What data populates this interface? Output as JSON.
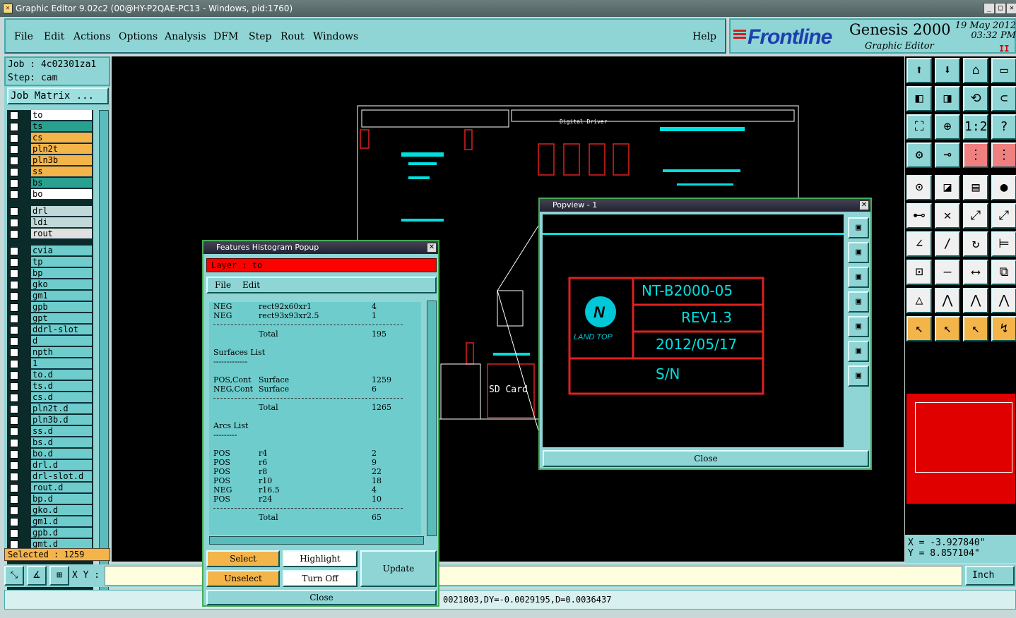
{
  "window": {
    "title": "Graphic Editor 9.02c2 (00@HY-P2QAE-PC13 - Windows, pid:1760)"
  },
  "menubar": {
    "items": [
      "File",
      "Edit",
      "Actions",
      "Options",
      "Analysis",
      "DFM",
      "Step",
      "Rout",
      "Windows"
    ],
    "help": "Help"
  },
  "brand": {
    "logo": "Frontline",
    "product": "Genesis 2000",
    "subtitle": "Graphic Editor",
    "date": "19 May 2012",
    "time": "03:32 PM",
    "pause": "II"
  },
  "job": {
    "job": "Job : 4c02301za1",
    "step": "Step: cam",
    "matrix_button": "Job Matrix ..."
  },
  "layers": [
    {
      "name": "to",
      "color": "#ffffff"
    },
    {
      "name": "ts",
      "color": "#2aa090"
    },
    {
      "name": "cs",
      "color": "#f3b44a"
    },
    {
      "name": "pln2t",
      "color": "#f3b44a"
    },
    {
      "name": "pln3b",
      "color": "#f3b44a"
    },
    {
      "name": "ss",
      "color": "#f3b44a"
    },
    {
      "name": "bs",
      "color": "#2aa090"
    },
    {
      "name": "bo",
      "color": "#ffffff"
    },
    {
      "name": "drl",
      "color": "#c0d8d8"
    },
    {
      "name": "ldi",
      "color": "#c0d8d8"
    },
    {
      "name": "rout",
      "color": "#e0e0e0"
    },
    {
      "name": "cvia",
      "color": "#6ecccc"
    },
    {
      "name": "tp",
      "color": "#6ecccc"
    },
    {
      "name": "bp",
      "color": "#6ecccc"
    },
    {
      "name": "gko",
      "color": "#6ecccc"
    },
    {
      "name": "gm1",
      "color": "#6ecccc"
    },
    {
      "name": "gpb",
      "color": "#6ecccc"
    },
    {
      "name": "gpt",
      "color": "#6ecccc"
    },
    {
      "name": "ddrl-slot",
      "color": "#6ecccc"
    },
    {
      "name": "d",
      "color": "#6ecccc"
    },
    {
      "name": "npth",
      "color": "#6ecccc"
    },
    {
      "name": "1",
      "color": "#6ecccc"
    },
    {
      "name": "to.d",
      "color": "#6ecccc"
    },
    {
      "name": "ts.d",
      "color": "#6ecccc"
    },
    {
      "name": "cs.d",
      "color": "#6ecccc"
    },
    {
      "name": "pln2t.d",
      "color": "#6ecccc"
    },
    {
      "name": "pln3b.d",
      "color": "#6ecccc"
    },
    {
      "name": "ss.d",
      "color": "#6ecccc"
    },
    {
      "name": "bs.d",
      "color": "#6ecccc"
    },
    {
      "name": "bo.d",
      "color": "#6ecccc"
    },
    {
      "name": "drl.d",
      "color": "#6ecccc"
    },
    {
      "name": "drl-slot.d",
      "color": "#6ecccc"
    },
    {
      "name": "rout.d",
      "color": "#6ecccc"
    },
    {
      "name": "bp.d",
      "color": "#6ecccc"
    },
    {
      "name": "gko.d",
      "color": "#6ecccc"
    },
    {
      "name": "gm1.d",
      "color": "#6ecccc"
    },
    {
      "name": "gpb.d",
      "color": "#6ecccc"
    },
    {
      "name": "gmt.d",
      "color": "#6ecccc"
    }
  ],
  "selected": "Selected : 1259",
  "coords": {
    "x": "X = -3.927840\"",
    "y": "Y = 8.857104\""
  },
  "bottombar": {
    "xy_label": "X Y :",
    "unit": "Inch"
  },
  "status": {
    "text": "0021803,DY=-0.0029195,D=0.0036437"
  },
  "histogram": {
    "title": "Features Histogram Popup",
    "layer": "Layer :  to",
    "menu": [
      "File",
      "Edit"
    ],
    "rows": [
      [
        "NEG",
        "rect92x60xr1",
        "4"
      ],
      [
        "NEG",
        "rect93x93xr2.5",
        "1"
      ],
      [
        "sep"
      ],
      [
        "",
        "Total",
        "195"
      ],
      [
        "",
        ""
      ],
      [
        "head",
        "Surfaces List"
      ],
      [
        "head",
        "-------------"
      ],
      [
        "",
        ""
      ],
      [
        "POS,Cont",
        "Surface",
        "1259"
      ],
      [
        "NEG,Cont",
        "Surface",
        "6"
      ],
      [
        "sep"
      ],
      [
        "",
        "Total",
        "1265"
      ],
      [
        "",
        ""
      ],
      [
        "head",
        "Arcs List"
      ],
      [
        "head",
        "---------"
      ],
      [
        "",
        ""
      ],
      [
        "POS",
        "r4",
        "2"
      ],
      [
        "POS",
        "r6",
        "9"
      ],
      [
        "POS",
        "r8",
        "22"
      ],
      [
        "POS",
        "r10",
        "18"
      ],
      [
        "NEG",
        "r16.5",
        "4"
      ],
      [
        "POS",
        "r24",
        "10"
      ],
      [
        "sep"
      ],
      [
        "",
        "Total",
        "65"
      ]
    ],
    "buttons": {
      "select": "Select",
      "highlight": "Highlight",
      "update": "Update",
      "unselect": "Unselect",
      "turnoff": "Turn Off",
      "close": "Close"
    }
  },
  "popview": {
    "title": "Popview - 1",
    "logo_text": "LAND TOP",
    "label_rows": [
      "NT-B2000-05",
      "REV1.3",
      "2012/05/17",
      "S/N"
    ],
    "close": "Close"
  },
  "pcb": {
    "labels": [
      "SD Card",
      "Digital Driver"
    ]
  }
}
